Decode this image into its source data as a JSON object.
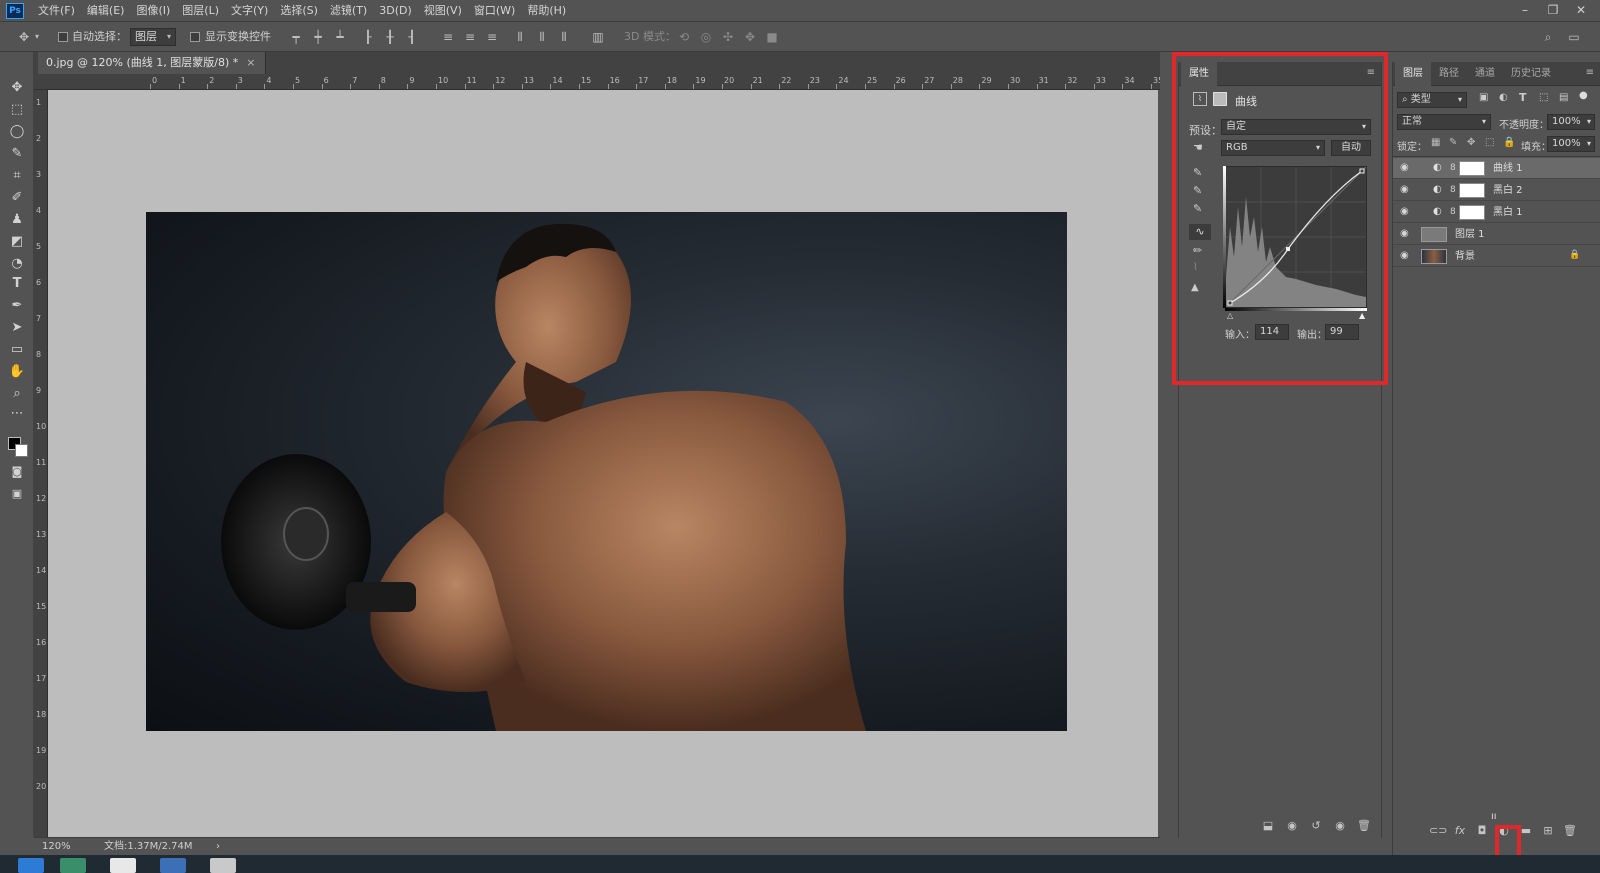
{
  "app": {
    "logo": "Ps",
    "menus": [
      "文件(F)",
      "编辑(E)",
      "图像(I)",
      "图层(L)",
      "文字(Y)",
      "选择(S)",
      "滤镜(T)",
      "3D(D)",
      "视图(V)",
      "窗口(W)",
      "帮助(H)"
    ],
    "window_controls": [
      "minimize-icon",
      "restore-icon",
      "close-icon"
    ]
  },
  "options_bar": {
    "auto_select_label": "自动选择：",
    "auto_select_value": "图层",
    "show_transform_label": "显示变换控件",
    "mode_3d_label": "3D 模式："
  },
  "document": {
    "tab_title": "0.jpg @ 120% (曲线 1, 图层蒙版/8) *",
    "ruler_ticks_h": [
      "0",
      "1",
      "2",
      "3",
      "4",
      "5",
      "6",
      "7",
      "8",
      "9",
      "10",
      "11",
      "12",
      "13",
      "14",
      "15",
      "16",
      "17",
      "18",
      "19",
      "20",
      "21",
      "22",
      "23",
      "24",
      "25",
      "26",
      "27",
      "28",
      "29",
      "30",
      "31",
      "32",
      "33",
      "34",
      "35"
    ],
    "ruler_ticks_v": [
      "1",
      "2",
      "3",
      "4",
      "5",
      "6",
      "7",
      "8",
      "9",
      "10",
      "11",
      "12",
      "13",
      "14",
      "15",
      "16",
      "17",
      "18",
      "19",
      "20"
    ],
    "zoom": "120%",
    "doc_info": "文档:1.37M/2.74M"
  },
  "properties": {
    "tab": "属性",
    "title": "曲线",
    "preset_label": "预设：",
    "preset_value": "自定",
    "channel": "RGB",
    "auto_button": "自动",
    "input_label": "输入：",
    "input_value": "114",
    "output_label": "输出：",
    "output_value": "99"
  },
  "layers": {
    "tabs": [
      "图层",
      "路径",
      "通道",
      "历史记录"
    ],
    "filter_value": "类型",
    "blend_mode": "正常",
    "opacity_label": "不透明度：",
    "opacity_value": "100%",
    "lock_label": "锁定：",
    "fill_label": "填充：",
    "fill_value": "100%",
    "items": [
      {
        "name": "曲线 1"
      },
      {
        "name": "黑白 2"
      },
      {
        "name": "黑白 1"
      },
      {
        "name": "图层 1"
      },
      {
        "name": "背景"
      }
    ]
  },
  "colors": {
    "highlight_border": "#e0282c",
    "selected_layer": "#6a6a6a"
  }
}
